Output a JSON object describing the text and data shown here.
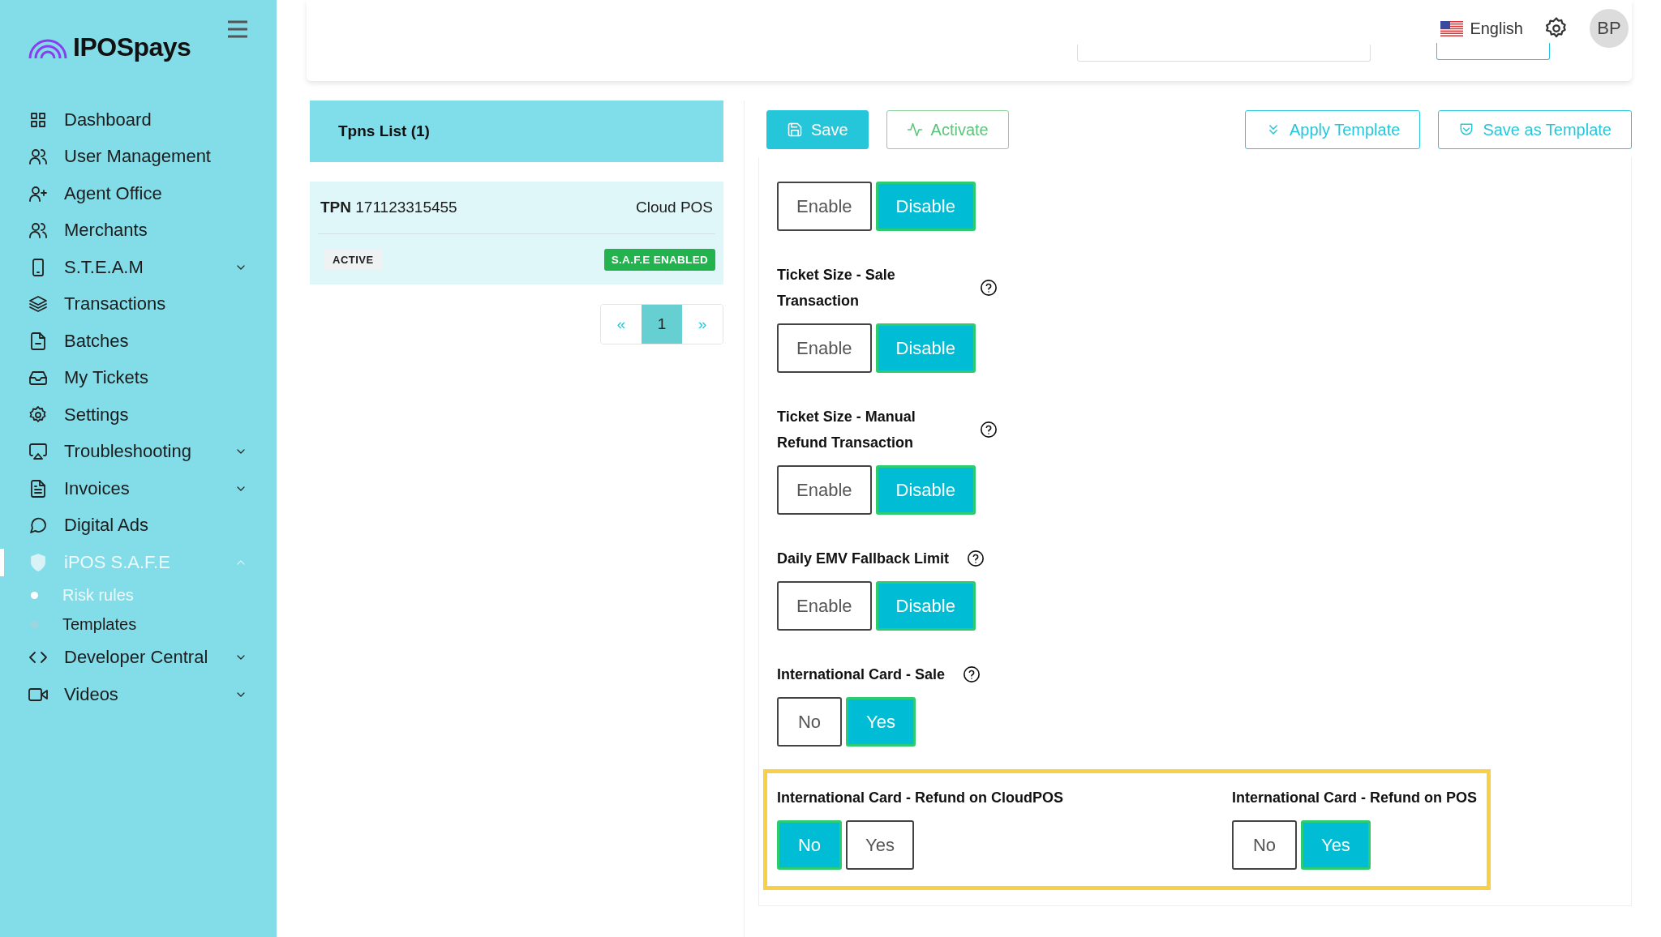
{
  "sidebar": {
    "logo": "IPOSpays",
    "items": [
      {
        "label": "Dashboard",
        "selected": false
      },
      {
        "label": "User Management",
        "selected": false
      },
      {
        "label": "Agent Office",
        "selected": false
      },
      {
        "label": "Merchants",
        "selected": false
      },
      {
        "label": "S.T.E.A.M",
        "selected": false,
        "expanded": false
      },
      {
        "label": "Transactions",
        "selected": false
      },
      {
        "label": "Batches",
        "selected": false
      },
      {
        "label": "My Tickets",
        "selected": false
      },
      {
        "label": "Settings",
        "selected": false
      },
      {
        "label": "Troubleshooting",
        "selected": false,
        "expanded": false
      },
      {
        "label": "Invoices",
        "selected": false,
        "expanded": false
      },
      {
        "label": "Digital Ads",
        "selected": false
      },
      {
        "label": "iPOS S.A.F.E",
        "selected": true,
        "expanded": true,
        "children": [
          {
            "label": "Risk rules",
            "selected": true
          },
          {
            "label": "Templates",
            "selected": false
          }
        ]
      },
      {
        "label": "Developer Central",
        "selected": false,
        "expanded": false
      },
      {
        "label": "Videos",
        "selected": false,
        "expanded": false
      }
    ]
  },
  "header": {
    "language": "English",
    "avatar": "BP"
  },
  "tpns": {
    "title": "Tpns List (1)",
    "items": [
      {
        "tpn_label": "TPN",
        "tpn": "171123315455",
        "type": "Cloud POS",
        "status": "ACTIVE",
        "badge": "S.A.F.E ENABLED",
        "selected": true
      }
    ],
    "pagination": {
      "prev": "«",
      "pages": [
        {
          "label": "1",
          "selected": true
        }
      ],
      "next": "»"
    }
  },
  "toolbar": [
    {
      "label": "Save",
      "kind": "primary"
    },
    {
      "label": "Activate",
      "kind": "success"
    },
    {
      "label": "Apply Template",
      "kind": "apply"
    },
    {
      "label": "Save as Template",
      "kind": "template"
    }
  ],
  "form": {
    "rows": [
      {
        "highlighted": false,
        "fields": [
          {
            "help": false,
            "options": [
              {
                "label": "Enable",
                "selected": false
              },
              {
                "label": "Disable",
                "selected": true
              }
            ]
          }
        ]
      },
      {
        "highlighted": false,
        "fields": [
          {
            "label": "Ticket Size - Sale Transaction",
            "help": true,
            "options": [
              {
                "label": "Enable",
                "selected": false
              },
              {
                "label": "Disable",
                "selected": true
              }
            ]
          }
        ]
      },
      {
        "highlighted": false,
        "fields": [
          {
            "label": "Ticket Size - Manual Refund Transaction",
            "help": true,
            "options": [
              {
                "label": "Enable",
                "selected": false
              },
              {
                "label": "Disable",
                "selected": true
              }
            ]
          }
        ]
      },
      {
        "highlighted": false,
        "fields": [
          {
            "label": "Daily EMV Fallback Limit",
            "help": true,
            "options": [
              {
                "label": "Enable",
                "selected": false
              },
              {
                "label": "Disable",
                "selected": true
              }
            ]
          }
        ]
      },
      {
        "highlighted": false,
        "fields": [
          {
            "label": "International Card - Sale",
            "help": true,
            "options": [
              {
                "label": "No",
                "selected": false
              },
              {
                "label": "Yes",
                "selected": true
              }
            ]
          }
        ]
      },
      {
        "highlighted": true,
        "fields": [
          {
            "label": "International Card - Refund on CloudPOS",
            "help": false,
            "options": [
              {
                "label": "No",
                "selected": true
              },
              {
                "label": "Yes",
                "selected": false
              }
            ]
          },
          {
            "label": "International Card - Refund on POS",
            "help": false,
            "options": [
              {
                "label": "No",
                "selected": false
              },
              {
                "label": "Yes",
                "selected": true
              }
            ]
          }
        ]
      }
    ]
  }
}
